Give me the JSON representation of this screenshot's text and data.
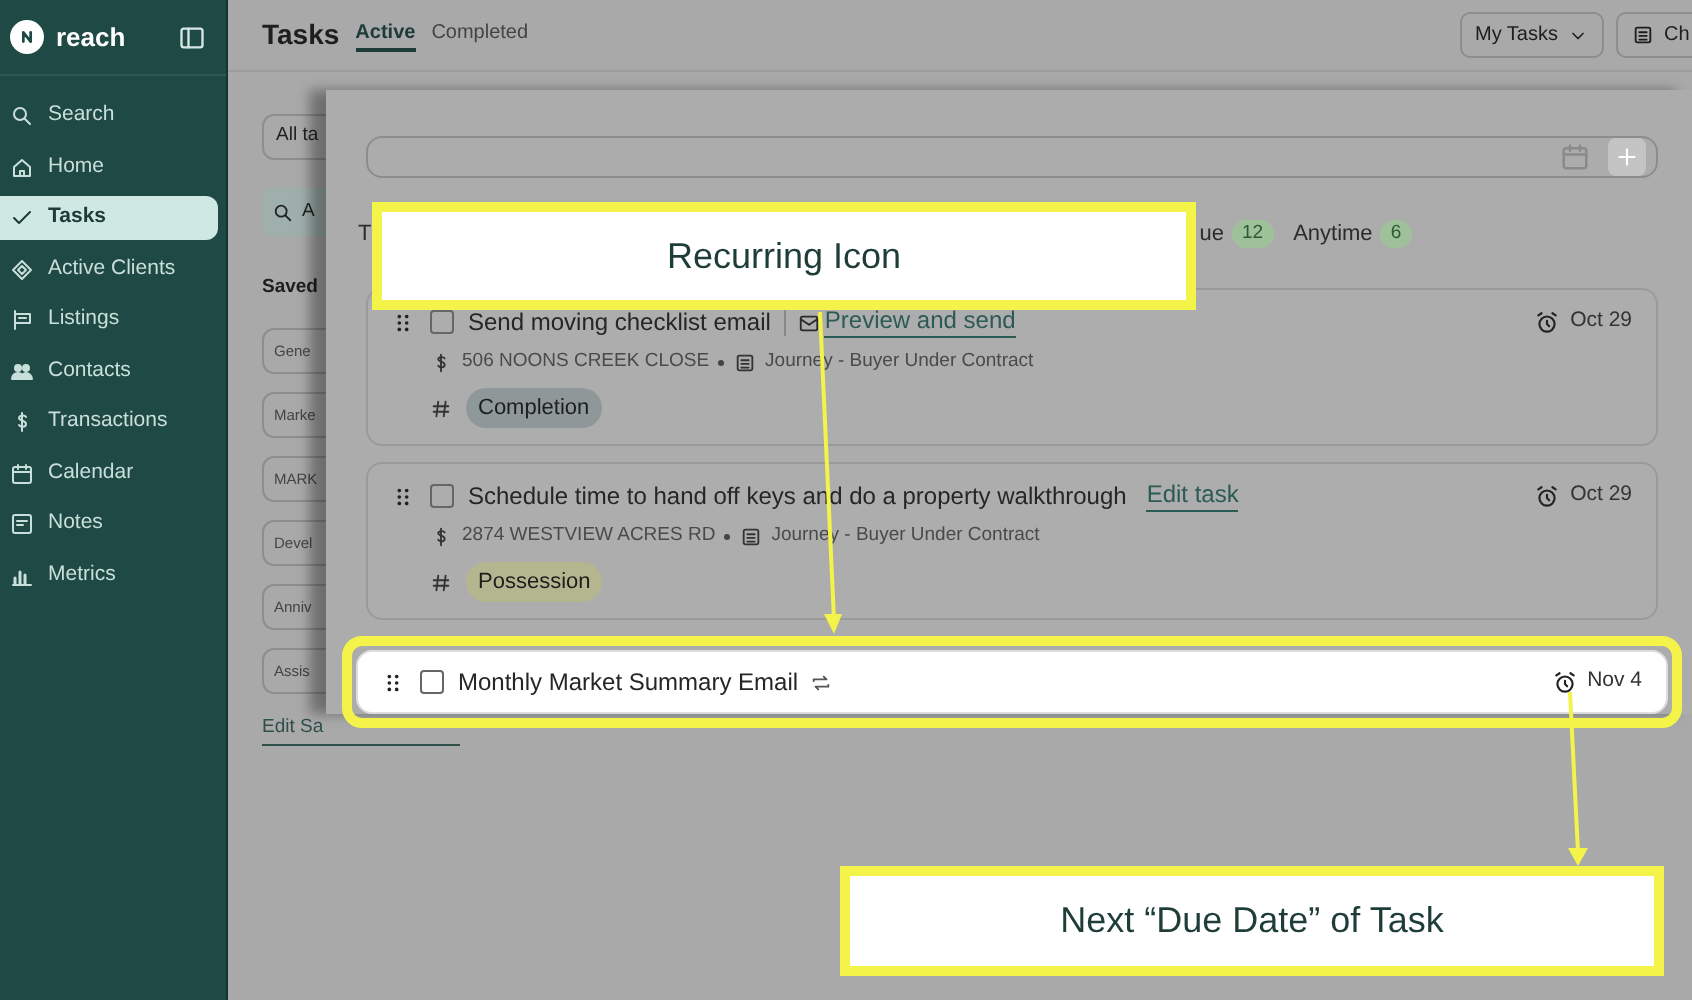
{
  "sidebar": {
    "logo": "reach",
    "items": [
      {
        "label": "Search",
        "selected": false
      },
      {
        "label": "Home",
        "selected": false
      },
      {
        "label": "Tasks",
        "selected": true
      },
      {
        "label": "Active Clients",
        "selected": false
      },
      {
        "label": "Listings",
        "selected": false
      },
      {
        "label": "Contacts",
        "selected": false
      },
      {
        "label": "Transactions",
        "selected": false
      },
      {
        "label": "Calendar",
        "selected": false
      },
      {
        "label": "Notes",
        "selected": false
      },
      {
        "label": "Metrics",
        "selected": false
      }
    ]
  },
  "header": {
    "title": "Tasks",
    "tabs": [
      {
        "label": "Active",
        "selected": true
      },
      {
        "label": "Completed",
        "selected": false
      }
    ],
    "filter": "My Tasks",
    "button": "Ch"
  },
  "filters": {
    "select": "All ta",
    "search": "A",
    "saved_label": "Saved",
    "saved_views": [
      "Gene",
      "Marke",
      "MARK",
      "Devel",
      "Anniv",
      "Assis"
    ],
    "edit_link": "Edit Sa"
  },
  "task_panel": {
    "tabs": [
      {
        "label": "T"
      },
      {
        "label": "ue",
        "count": "12"
      },
      {
        "label": "Anytime",
        "count": "6"
      }
    ],
    "tasks": [
      {
        "title": "Send moving checklist email",
        "kind": "email",
        "action": "Preview and send",
        "checked": false,
        "recurring": false,
        "highlighted": false,
        "due": "Oct 29",
        "address": "506 NOONS CREEK CLOSE",
        "journey": "Journey - Buyer Under Contract",
        "tag": "Completion",
        "color": "#8e9898"
      },
      {
        "title": "Schedule time to hand off keys and do a property walkthrough",
        "kind": "edit",
        "action": "Edit task",
        "checked": false,
        "recurring": false,
        "highlighted": false,
        "due": "Oct 29",
        "address": "2874 WESTVIEW ACRES RD",
        "journey": "Journey - Buyer Under Contract",
        "tag": "Possession",
        "color": "#b4b690"
      },
      {
        "title": "Monthly Market Summary Email",
        "checked": false,
        "recurring": true,
        "highlighted": true,
        "due": "Nov 4"
      }
    ]
  },
  "callouts": [
    {
      "text": "Recurring Icon"
    },
    {
      "text": "Next “Due Date” of Task"
    }
  ]
}
